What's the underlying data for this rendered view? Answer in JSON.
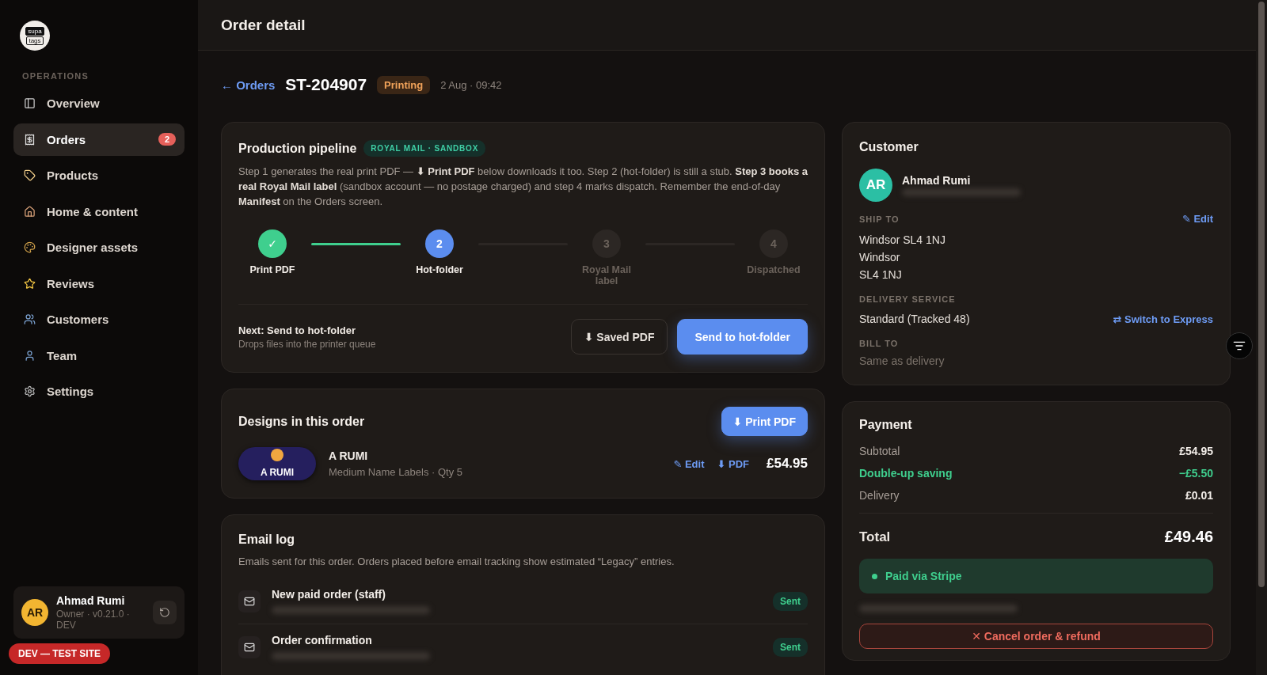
{
  "sidebar": {
    "logo": [
      "supa",
      "tags"
    ],
    "section_label": "OPERATIONS",
    "items": [
      {
        "label": "Overview",
        "selected": false
      },
      {
        "label": "Orders",
        "selected": true,
        "badge": "2"
      },
      {
        "label": "Products",
        "selected": false
      },
      {
        "label": "Home & content",
        "selected": false
      },
      {
        "label": "Designer assets",
        "selected": false
      },
      {
        "label": "Reviews",
        "selected": false
      },
      {
        "label": "Customers",
        "selected": false
      },
      {
        "label": "Team",
        "selected": false
      },
      {
        "label": "Settings",
        "selected": false
      }
    ],
    "user": {
      "initials": "AR",
      "name": "Ahmad Rumi",
      "meta": "Owner · v0.21.0 · DEV"
    },
    "env_badge": "DEV — TEST SITE"
  },
  "header": {
    "title": "Order detail"
  },
  "order": {
    "back_link": "← Orders",
    "number": "ST-204907",
    "status": "Printing",
    "date": "2 Aug · 09:42"
  },
  "pipeline": {
    "title": "Production pipeline",
    "tag": "ROYAL MAIL · SANDBOX",
    "description": "Step 1 generates the real print PDF — **⬇ Print PDF** below downloads it too. Step 2 (hot-folder) is still a stub. **Step 3 books a real Royal Mail label** (sandbox account — no postage charged) and step 4 marks dispatch. Remember the end-of-day **Manifest** on the Orders screen.",
    "steps": [
      {
        "marker": "✓",
        "label": "Print PDF",
        "kind": "done"
      },
      {
        "marker": "2",
        "label": "Hot-folder",
        "kind": "current"
      },
      {
        "marker": "3",
        "label": "Royal Mail label",
        "kind": "pending"
      },
      {
        "marker": "4",
        "label": "Dispatched",
        "kind": "pending"
      }
    ],
    "next": {
      "title": "Next: Send to hot-folder",
      "subtitle": "Drops files into the printer queue"
    },
    "buttons": [
      {
        "label": "⬇ Saved PDF",
        "kind": "secondary"
      },
      {
        "label": "Send to hot-folder",
        "kind": "primary"
      }
    ]
  },
  "designs": {
    "title": "Designs in this order",
    "print_button": "⬇ Print PDF",
    "items": [
      {
        "thumb_text": "A RUMI",
        "name": "A RUMI",
        "details": "Medium Name Labels · Qty 5",
        "edit": "✎ Edit",
        "pdf": "⬇ PDF",
        "price": "£54.95"
      }
    ]
  },
  "email_log": {
    "title": "Email log",
    "description": "Emails sent for this order. Orders placed before email tracking show estimated “Legacy” entries.",
    "entries": [
      {
        "title": "New paid order (staff)",
        "status": "Sent"
      },
      {
        "title": "Order confirmation",
        "status": "Sent"
      }
    ]
  },
  "customer": {
    "title": "Customer",
    "initials": "AR",
    "name": "Ahmad Rumi",
    "ship_to_label": "SHIP TO",
    "edit": "✎ Edit",
    "address": [
      "Windsor SL4 1NJ",
      "Windsor",
      "SL4 1NJ"
    ],
    "delivery_label": "DELIVERY SERVICE",
    "delivery": "Standard (Tracked 48)",
    "switch_link": "⇄ Switch to Express",
    "bill_to_label": "BILL TO",
    "bill_to": "Same as delivery"
  },
  "payment": {
    "title": "Payment",
    "lines": [
      {
        "label": "Subtotal",
        "value": "£54.95",
        "kind": "normal"
      },
      {
        "label": "Double-up saving",
        "value": "−£5.50",
        "kind": "saving"
      },
      {
        "label": "Delivery",
        "value": "£0.01",
        "kind": "normal"
      }
    ],
    "total_label": "Total",
    "total": "£49.46",
    "status": "Paid via Stripe",
    "cancel": "✕ Cancel order & refund"
  }
}
